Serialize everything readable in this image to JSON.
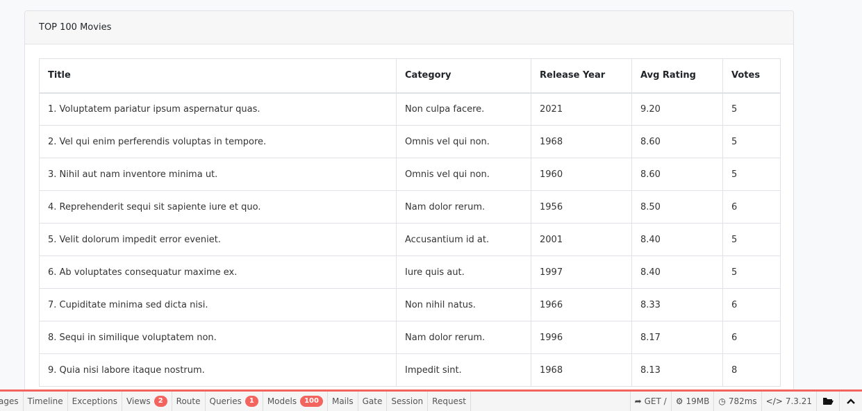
{
  "card": {
    "title": "TOP 100 Movies"
  },
  "table": {
    "headers": [
      "Title",
      "Category",
      "Release Year",
      "Avg Rating",
      "Votes"
    ],
    "rows": [
      [
        "1. Voluptatem pariatur ipsum aspernatur quas.",
        "Non culpa facere.",
        "2021",
        "9.20",
        "5"
      ],
      [
        "2. Vel qui enim perferendis voluptas in tempore.",
        "Omnis vel qui non.",
        "1968",
        "8.60",
        "5"
      ],
      [
        "3. Nihil aut nam inventore minima ut.",
        "Omnis vel qui non.",
        "1960",
        "8.60",
        "5"
      ],
      [
        "4. Reprehenderit sequi sit sapiente iure et quo.",
        "Nam dolor rerum.",
        "1956",
        "8.50",
        "6"
      ],
      [
        "5. Velit dolorum impedit error eveniet.",
        "Accusantium id at.",
        "2001",
        "8.40",
        "5"
      ],
      [
        "6. Ab voluptates consequatur maxime ex.",
        "Iure quis aut.",
        "1997",
        "8.40",
        "5"
      ],
      [
        "7. Cupiditate minima sed dicta nisi.",
        "Non nihil natus.",
        "1966",
        "8.33",
        "6"
      ],
      [
        "8. Sequi in similique voluptatem non.",
        "Nam dolor rerum.",
        "1996",
        "8.17",
        "6"
      ],
      [
        "9. Quia nisi labore itaque nostrum.",
        "Impedit sint.",
        "1968",
        "8.13",
        "8"
      ]
    ]
  },
  "debugbar": {
    "tabs": [
      {
        "label": "ages",
        "badge": null
      },
      {
        "label": "Timeline",
        "badge": null
      },
      {
        "label": "Exceptions",
        "badge": null
      },
      {
        "label": "Views",
        "badge": "2"
      },
      {
        "label": "Route",
        "badge": null
      },
      {
        "label": "Queries",
        "badge": "1"
      },
      {
        "label": "Models",
        "badge": "100"
      },
      {
        "label": "Mails",
        "badge": null
      },
      {
        "label": "Gate",
        "badge": null
      },
      {
        "label": "Session",
        "badge": null
      },
      {
        "label": "Request",
        "badge": null
      }
    ],
    "method": "GET /",
    "memory": "19MB",
    "time": "782ms",
    "version": "7.3.21",
    "accent_color": "#f4645f"
  }
}
